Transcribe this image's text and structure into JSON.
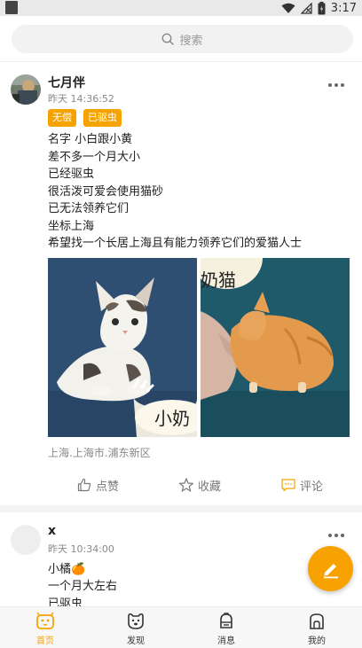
{
  "status_bar": {
    "time": "3:17"
  },
  "search": {
    "placeholder": "搜索"
  },
  "posts": [
    {
      "username": "七月伴",
      "time": "昨天 14:36:52",
      "tags": [
        "无偿",
        "已驱虫"
      ],
      "lines": [
        "名字 小白跟小黄",
        "差不多一个月大小",
        "已经驱虫",
        "很活泼可爱会使用猫砂",
        "已无法领养它们",
        "坐标上海",
        "希望找一个长居上海且有能力领养它们的爱猫人士"
      ],
      "photos": [
        {
          "caption": "小奶"
        },
        {
          "caption": "奶猫"
        }
      ],
      "location": "上海.上海市.浦东新区",
      "actions": {
        "like": "点赞",
        "collect": "收藏",
        "comment": "评论"
      }
    },
    {
      "username": "x",
      "time": "昨天 10:34:00",
      "lines": [
        "小橘🍊",
        "一个月大左右",
        "已驱虫"
      ]
    }
  ],
  "tabs": [
    {
      "label": "首页",
      "icon": "home-icon",
      "active": true
    },
    {
      "label": "发现",
      "icon": "discover-icon",
      "active": false
    },
    {
      "label": "消息",
      "icon": "message-icon",
      "active": false
    },
    {
      "label": "我的",
      "icon": "profile-icon",
      "active": false
    }
  ],
  "colors": {
    "accent": "#f5a300",
    "fab": "#f7a200"
  }
}
